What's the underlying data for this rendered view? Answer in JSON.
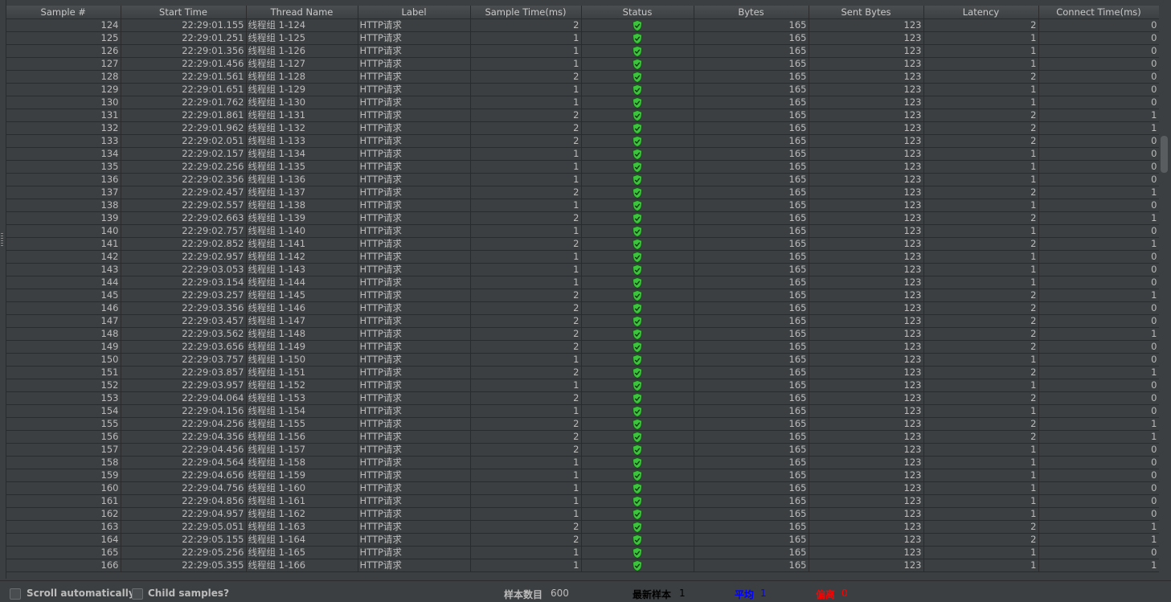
{
  "columns": [
    "Sample #",
    "Start Time",
    "Thread Name",
    "Label",
    "Sample Time(ms)",
    "Status",
    "Bytes",
    "Sent Bytes",
    "Latency",
    "Connect Time(ms)"
  ],
  "status_icon": "green-shield-check-icon",
  "rows": [
    [
      "124",
      "22:29:01.155",
      "线程组 1-124",
      "HTTP请求",
      "2",
      "165",
      "123",
      "2",
      "0"
    ],
    [
      "125",
      "22:29:01.251",
      "线程组 1-125",
      "HTTP请求",
      "1",
      "165",
      "123",
      "1",
      "0"
    ],
    [
      "126",
      "22:29:01.356",
      "线程组 1-126",
      "HTTP请求",
      "1",
      "165",
      "123",
      "1",
      "0"
    ],
    [
      "127",
      "22:29:01.456",
      "线程组 1-127",
      "HTTP请求",
      "1",
      "165",
      "123",
      "1",
      "0"
    ],
    [
      "128",
      "22:29:01.561",
      "线程组 1-128",
      "HTTP请求",
      "2",
      "165",
      "123",
      "2",
      "0"
    ],
    [
      "129",
      "22:29:01.651",
      "线程组 1-129",
      "HTTP请求",
      "1",
      "165",
      "123",
      "1",
      "0"
    ],
    [
      "130",
      "22:29:01.762",
      "线程组 1-130",
      "HTTP请求",
      "1",
      "165",
      "123",
      "1",
      "0"
    ],
    [
      "131",
      "22:29:01.861",
      "线程组 1-131",
      "HTTP请求",
      "2",
      "165",
      "123",
      "2",
      "1"
    ],
    [
      "132",
      "22:29:01.962",
      "线程组 1-132",
      "HTTP请求",
      "2",
      "165",
      "123",
      "2",
      "1"
    ],
    [
      "133",
      "22:29:02.051",
      "线程组 1-133",
      "HTTP请求",
      "2",
      "165",
      "123",
      "2",
      "0"
    ],
    [
      "134",
      "22:29:02.157",
      "线程组 1-134",
      "HTTP请求",
      "1",
      "165",
      "123",
      "1",
      "0"
    ],
    [
      "135",
      "22:29:02.256",
      "线程组 1-135",
      "HTTP请求",
      "1",
      "165",
      "123",
      "1",
      "0"
    ],
    [
      "136",
      "22:29:02.356",
      "线程组 1-136",
      "HTTP请求",
      "1",
      "165",
      "123",
      "1",
      "0"
    ],
    [
      "137",
      "22:29:02.457",
      "线程组 1-137",
      "HTTP请求",
      "2",
      "165",
      "123",
      "2",
      "1"
    ],
    [
      "138",
      "22:29:02.557",
      "线程组 1-138",
      "HTTP请求",
      "1",
      "165",
      "123",
      "1",
      "0"
    ],
    [
      "139",
      "22:29:02.663",
      "线程组 1-139",
      "HTTP请求",
      "2",
      "165",
      "123",
      "2",
      "1"
    ],
    [
      "140",
      "22:29:02.757",
      "线程组 1-140",
      "HTTP请求",
      "1",
      "165",
      "123",
      "1",
      "0"
    ],
    [
      "141",
      "22:29:02.852",
      "线程组 1-141",
      "HTTP请求",
      "2",
      "165",
      "123",
      "2",
      "1"
    ],
    [
      "142",
      "22:29:02.957",
      "线程组 1-142",
      "HTTP请求",
      "1",
      "165",
      "123",
      "1",
      "0"
    ],
    [
      "143",
      "22:29:03.053",
      "线程组 1-143",
      "HTTP请求",
      "1",
      "165",
      "123",
      "1",
      "0"
    ],
    [
      "144",
      "22:29:03.154",
      "线程组 1-144",
      "HTTP请求",
      "1",
      "165",
      "123",
      "1",
      "0"
    ],
    [
      "145",
      "22:29:03.257",
      "线程组 1-145",
      "HTTP请求",
      "2",
      "165",
      "123",
      "2",
      "1"
    ],
    [
      "146",
      "22:29:03.356",
      "线程组 1-146",
      "HTTP请求",
      "2",
      "165",
      "123",
      "2",
      "0"
    ],
    [
      "147",
      "22:29:03.457",
      "线程组 1-147",
      "HTTP请求",
      "2",
      "165",
      "123",
      "2",
      "0"
    ],
    [
      "148",
      "22:29:03.562",
      "线程组 1-148",
      "HTTP请求",
      "2",
      "165",
      "123",
      "2",
      "1"
    ],
    [
      "149",
      "22:29:03.656",
      "线程组 1-149",
      "HTTP请求",
      "2",
      "165",
      "123",
      "2",
      "0"
    ],
    [
      "150",
      "22:29:03.757",
      "线程组 1-150",
      "HTTP请求",
      "1",
      "165",
      "123",
      "1",
      "0"
    ],
    [
      "151",
      "22:29:03.857",
      "线程组 1-151",
      "HTTP请求",
      "2",
      "165",
      "123",
      "2",
      "1"
    ],
    [
      "152",
      "22:29:03.957",
      "线程组 1-152",
      "HTTP请求",
      "1",
      "165",
      "123",
      "1",
      "0"
    ],
    [
      "153",
      "22:29:04.064",
      "线程组 1-153",
      "HTTP请求",
      "2",
      "165",
      "123",
      "2",
      "0"
    ],
    [
      "154",
      "22:29:04.156",
      "线程组 1-154",
      "HTTP请求",
      "1",
      "165",
      "123",
      "1",
      "0"
    ],
    [
      "155",
      "22:29:04.256",
      "线程组 1-155",
      "HTTP请求",
      "2",
      "165",
      "123",
      "2",
      "1"
    ],
    [
      "156",
      "22:29:04.356",
      "线程组 1-156",
      "HTTP请求",
      "2",
      "165",
      "123",
      "2",
      "1"
    ],
    [
      "157",
      "22:29:04.456",
      "线程组 1-157",
      "HTTP请求",
      "2",
      "165",
      "123",
      "1",
      "0"
    ],
    [
      "158",
      "22:29:04.564",
      "线程组 1-158",
      "HTTP请求",
      "1",
      "165",
      "123",
      "1",
      "0"
    ],
    [
      "159",
      "22:29:04.656",
      "线程组 1-159",
      "HTTP请求",
      "1",
      "165",
      "123",
      "1",
      "0"
    ],
    [
      "160",
      "22:29:04.756",
      "线程组 1-160",
      "HTTP请求",
      "1",
      "165",
      "123",
      "1",
      "0"
    ],
    [
      "161",
      "22:29:04.856",
      "线程组 1-161",
      "HTTP请求",
      "1",
      "165",
      "123",
      "1",
      "0"
    ],
    [
      "162",
      "22:29:04.957",
      "线程组 1-162",
      "HTTP请求",
      "1",
      "165",
      "123",
      "1",
      "0"
    ],
    [
      "163",
      "22:29:05.051",
      "线程组 1-163",
      "HTTP请求",
      "2",
      "165",
      "123",
      "2",
      "1"
    ],
    [
      "164",
      "22:29:05.155",
      "线程组 1-164",
      "HTTP请求",
      "2",
      "165",
      "123",
      "2",
      "1"
    ],
    [
      "165",
      "22:29:05.256",
      "线程组 1-165",
      "HTTP请求",
      "1",
      "165",
      "123",
      "1",
      "0"
    ],
    [
      "166",
      "22:29:05.355",
      "线程组 1-166",
      "HTTP请求",
      "1",
      "165",
      "123",
      "1",
      "1"
    ]
  ],
  "footer": {
    "scroll_auto_label": "Scroll automatically?",
    "child_samples_label": "Child samples?",
    "sample_count_label": "样本数目",
    "sample_count_value": "600",
    "latest_sample_label": "最新样本",
    "latest_sample_value": "1",
    "average_label": "平均",
    "average_value": "1",
    "deviation_label": "偏离",
    "deviation_value": "0"
  },
  "colors": {
    "background": "#3c3f41",
    "status_ok": "#3cc43c",
    "average": "#0000ff",
    "deviation": "#ff0000"
  }
}
